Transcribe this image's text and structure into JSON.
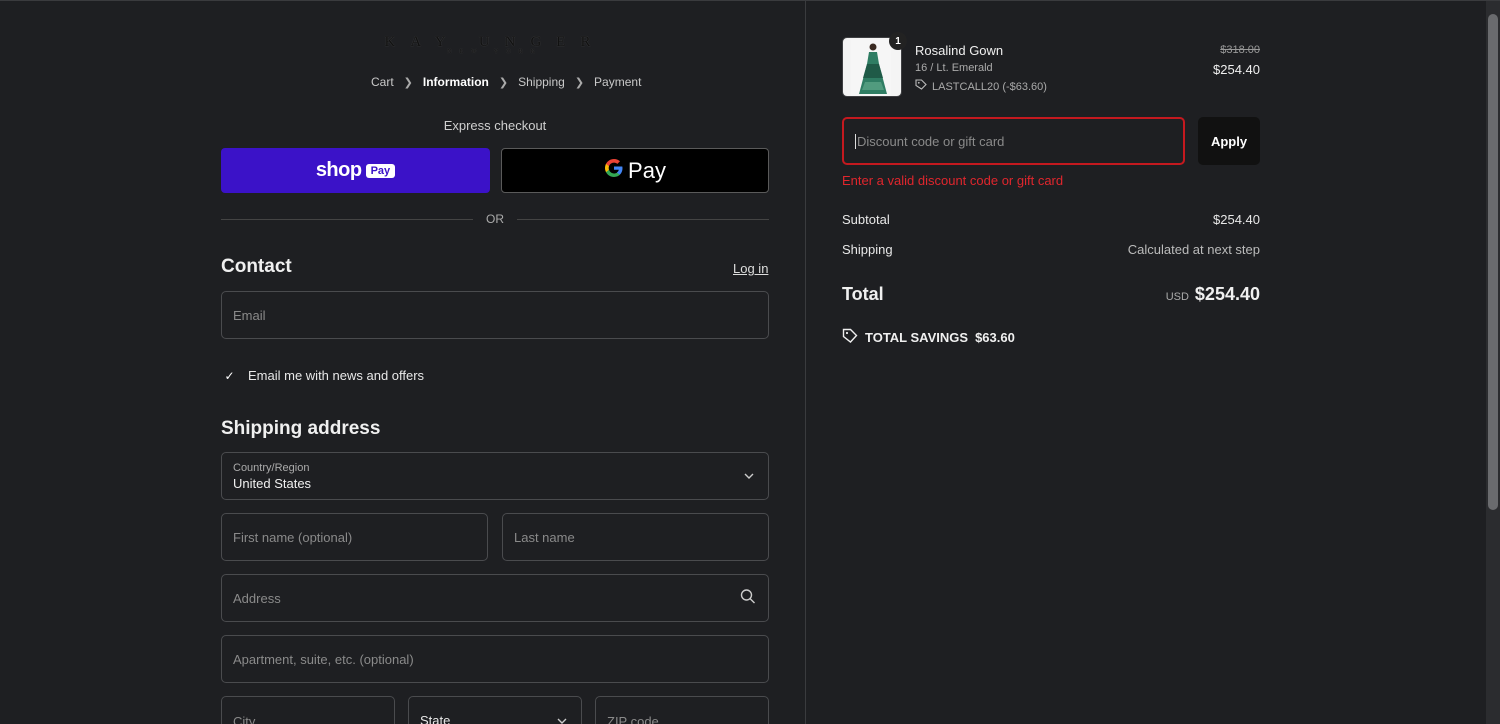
{
  "brand": {
    "name": "KAY UNGER",
    "sub": "NEW YORK"
  },
  "breadcrumbs": [
    "Cart",
    "Information",
    "Shipping",
    "Payment"
  ],
  "express": {
    "label": "Express checkout",
    "shoppay_shop": "shop",
    "shoppay_pay": "Pay",
    "gpay_g": "G",
    "gpay_pay": "Pay",
    "or": "OR"
  },
  "contact": {
    "title": "Contact",
    "login": "Log in",
    "email_placeholder": "Email",
    "newsletter_label": "Email me with news and offers",
    "newsletter_checked": true
  },
  "shipping": {
    "title": "Shipping address",
    "country_label": "Country/Region",
    "country_value": "United States",
    "first_name_placeholder": "First name (optional)",
    "last_name_placeholder": "Last name",
    "address_placeholder": "Address",
    "apartment_placeholder": "Apartment, suite, etc. (optional)",
    "city_placeholder": "City",
    "state_label": "State",
    "zip_placeholder": "ZIP code"
  },
  "order": {
    "quantity": "1",
    "product_name": "Rosalind Gown",
    "variant": "16 / Lt. Emerald",
    "discount_tag": "LASTCALL20 (-$63.60)",
    "original_price": "$318.00",
    "price": "$254.40",
    "discount_placeholder": "Discount code or gift card",
    "apply_label": "Apply",
    "error": "Enter a valid discount code or gift card",
    "subtotal_label": "Subtotal",
    "subtotal": "$254.40",
    "shipping_label": "Shipping",
    "shipping_value": "Calculated at next step",
    "total_label": "Total",
    "currency": "USD",
    "total": "$254.40",
    "savings_label": "TOTAL SAVINGS",
    "savings": "$63.60"
  },
  "colors": {
    "shoppay": "#3b12c8",
    "error": "#e0262d",
    "background": "#1e1f22"
  }
}
